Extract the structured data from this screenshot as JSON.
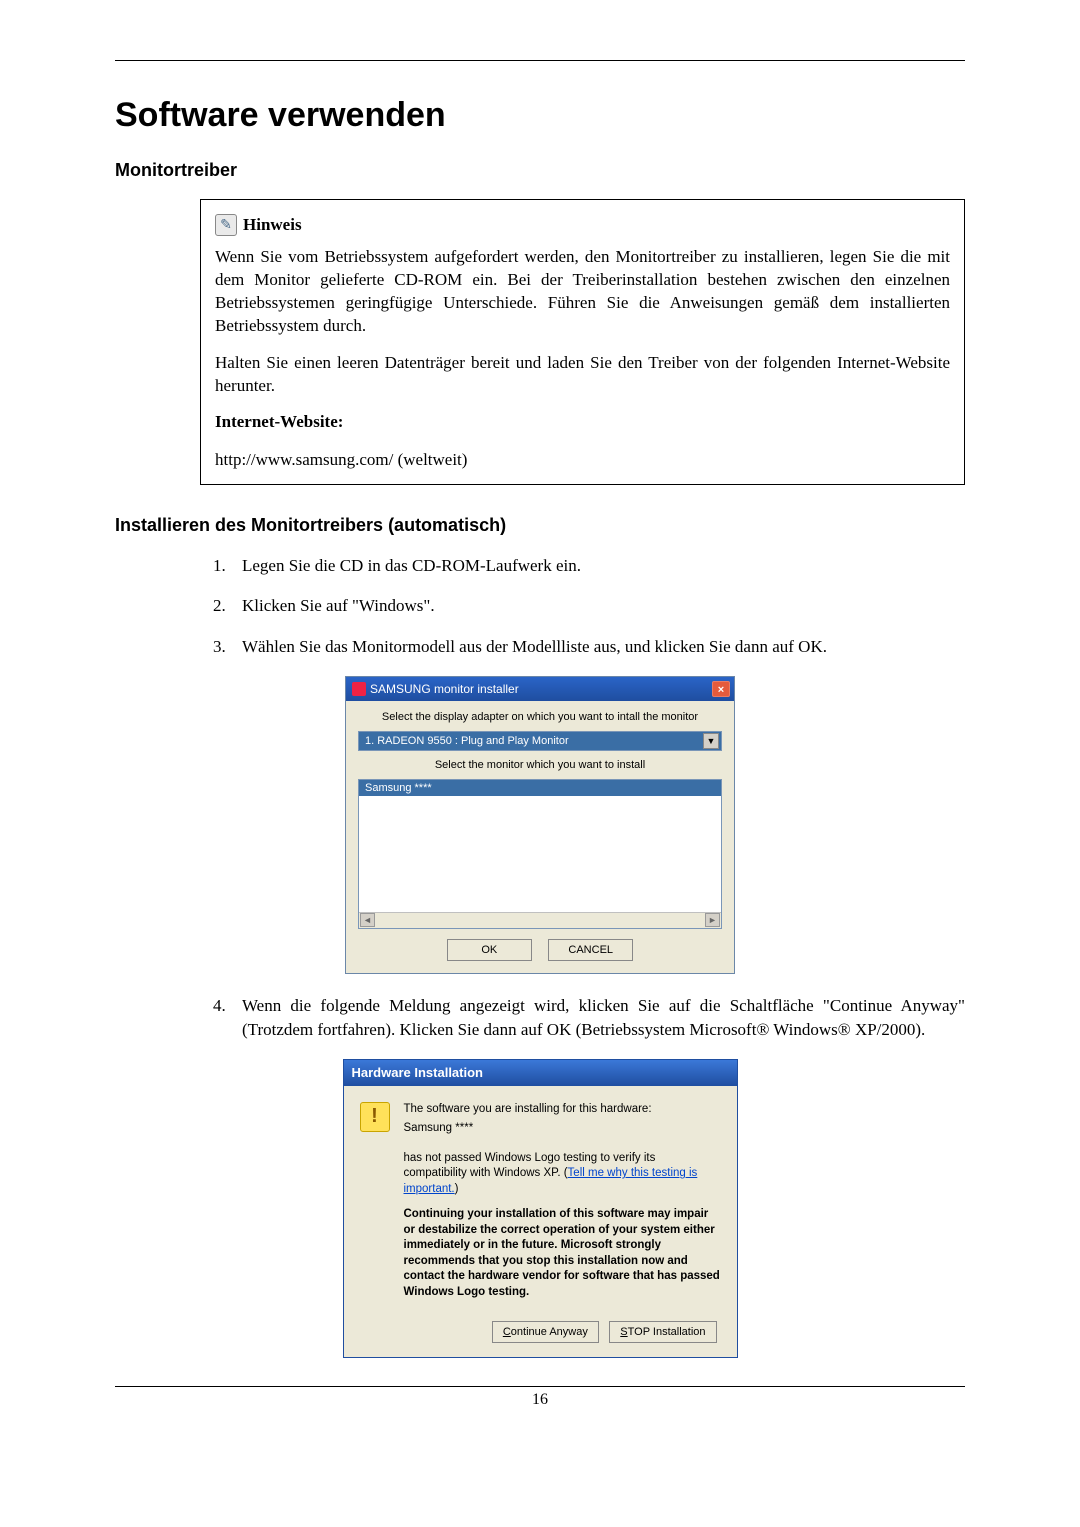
{
  "page": {
    "title": "Software verwenden",
    "section1_heading": "Monitortreiber",
    "section2_heading": "Installieren des Monitortreibers (automatisch)",
    "page_number": "16"
  },
  "note": {
    "icon_name": "note-icon",
    "title": "Hinweis",
    "para1": "Wenn Sie vom Betriebssystem aufgefordert werden, den Monitortreiber zu installieren, legen Sie die mit dem Monitor gelieferte CD-ROM ein. Bei der Treiberinstallation bestehen zwischen den einzelnen Betriebssystemen geringfügige Unterschiede. Führen Sie die Anweisungen gemäß dem installierten Betriebssystem durch.",
    "para2": "Halten Sie einen leeren Datenträger bereit und laden Sie den Treiber von der folgenden Internet-Website herunter.",
    "website_label": "Internet-Website:",
    "url": "http://www.samsung.com/ (weltweit)"
  },
  "steps": [
    "Legen Sie die CD in das CD-ROM-Laufwerk ein.",
    "Klicken Sie auf \"Windows\".",
    "Wählen Sie das Monitormodell aus der Modellliste aus, und klicken Sie dann auf OK.",
    "Wenn die folgende Meldung angezeigt wird, klicken Sie auf die Schaltfläche \"Continue Anyway\" (Trotzdem fortfahren). Klicken Sie dann auf OK (Betriebssystem Microsoft® Windows® XP/2000)."
  ],
  "installer": {
    "title": "SAMSUNG monitor installer",
    "close_label": "×",
    "text1": "Select the display adapter on which you want to intall the monitor",
    "select_value": "1. RADEON 9550 : Plug and Play Monitor",
    "text2": "Select the monitor which you want to install",
    "list_selected": "Samsung ****",
    "btn_ok": "OK",
    "btn_cancel": "CANCEL"
  },
  "hw_dialog": {
    "title": "Hardware Installation",
    "icon_glyph": "!",
    "line1": "The software you are installing for this hardware:",
    "product": "Samsung ****",
    "line2a": "has not passed Windows Logo testing to verify its compatibility with Windows XP. (",
    "link_text": "Tell me why this testing is important.",
    "line2b": ")",
    "line3": "Continuing your installation of this software may impair or destabilize the correct operation of your system either immediately or in the future. Microsoft strongly recommends that you stop this installation now and contact the hardware vendor for software that has passed Windows Logo testing.",
    "btn_continue_pre": "C",
    "btn_continue_rest": "ontinue Anyway",
    "btn_stop_pre": "S",
    "btn_stop_rest": "TOP Installation"
  }
}
